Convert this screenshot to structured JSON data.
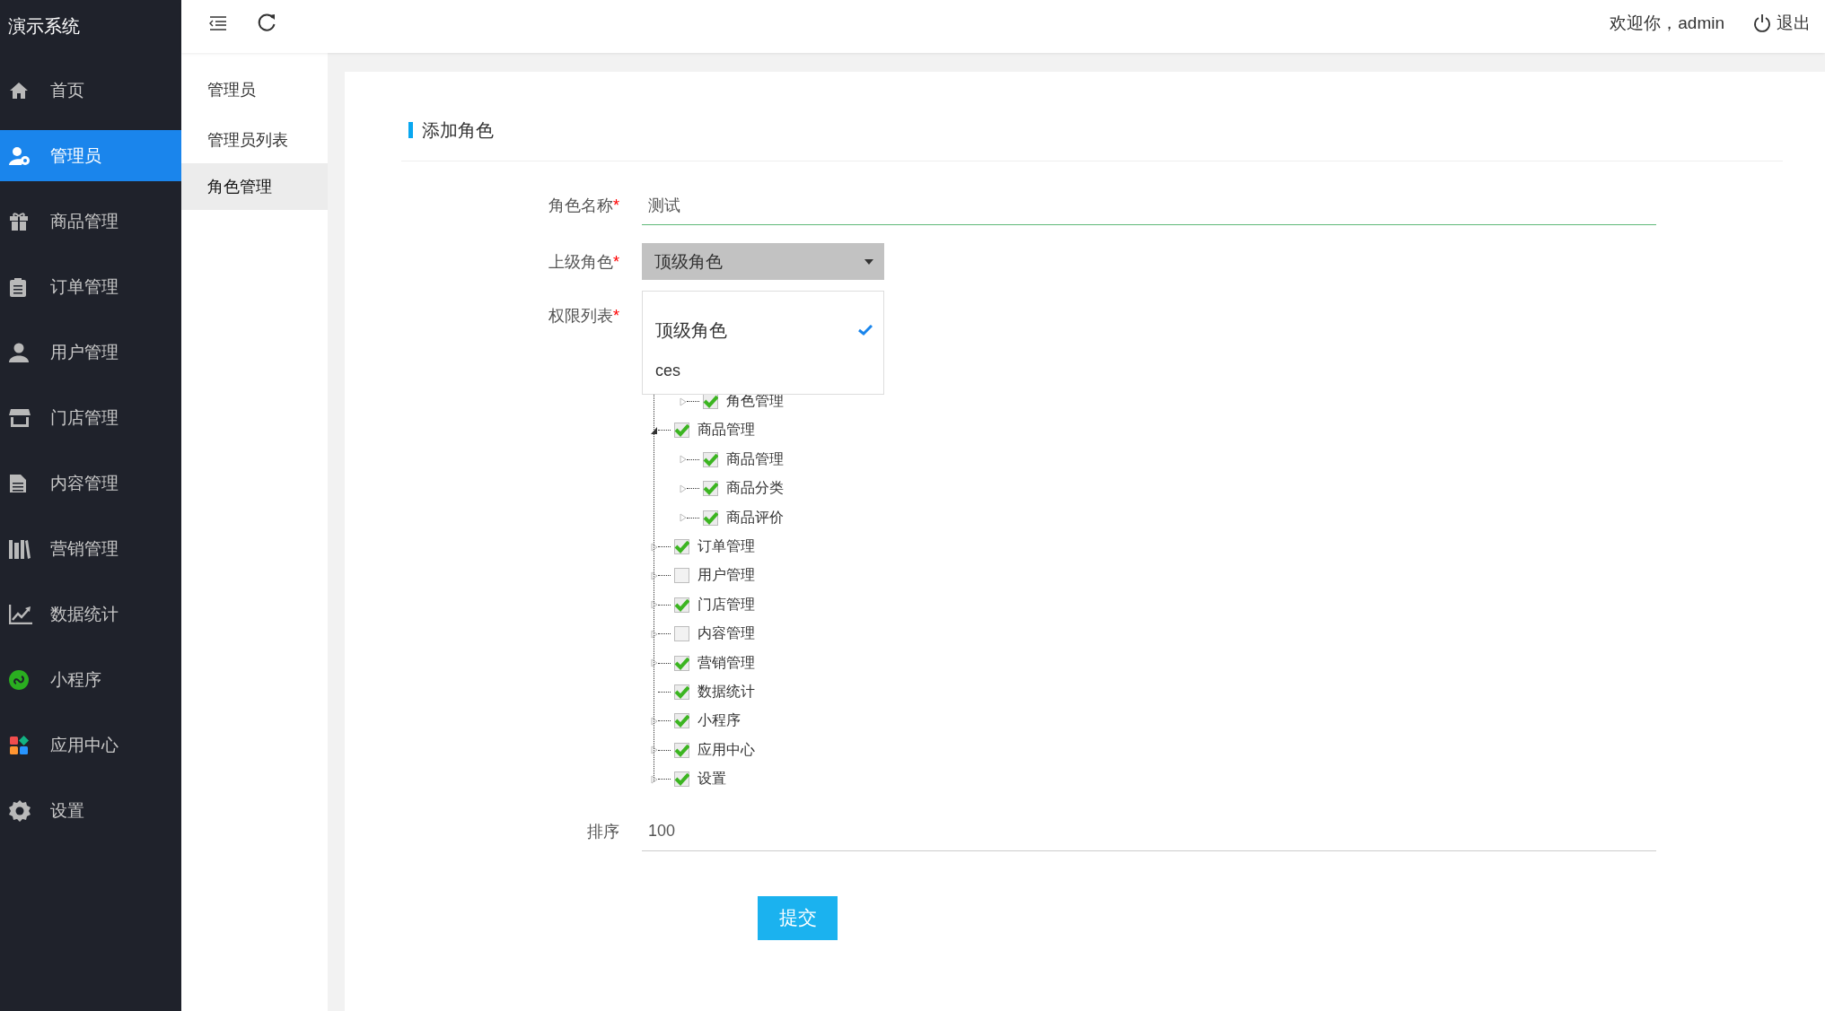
{
  "app": {
    "title": "演示系统"
  },
  "sidebar": {
    "items": [
      {
        "label": "首页",
        "selected": false
      },
      {
        "label": "管理员",
        "selected": true
      },
      {
        "label": "商品管理",
        "selected": false
      },
      {
        "label": "订单管理",
        "selected": false
      },
      {
        "label": "用户管理",
        "selected": false
      },
      {
        "label": "门店管理",
        "selected": false
      },
      {
        "label": "内容管理",
        "selected": false
      },
      {
        "label": "营销管理",
        "selected": false
      },
      {
        "label": "数据统计",
        "selected": false
      },
      {
        "label": "小程序",
        "selected": false
      },
      {
        "label": "应用中心",
        "selected": false
      },
      {
        "label": "设置",
        "selected": false
      }
    ]
  },
  "header": {
    "welcome": "欢迎你，admin",
    "logout": "退出"
  },
  "submenu": {
    "title": "管理员",
    "items": [
      {
        "label": "管理员列表",
        "selected": false
      },
      {
        "label": "角色管理",
        "selected": true
      }
    ]
  },
  "form": {
    "title": "添加角色",
    "name": {
      "label": "角色名称",
      "marker": "*",
      "value": "测试"
    },
    "parent": {
      "label": "上级角色",
      "marker": "*",
      "value": "顶级角色",
      "options": [
        {
          "label": "顶级角色",
          "selected": true
        },
        {
          "label": "ces",
          "selected": false
        }
      ]
    },
    "permissions": {
      "label": "权限列表",
      "marker": "*",
      "tree": [
        {
          "expanded": true,
          "children": [
            {
              "label": "角色管理",
              "checked": true,
              "expanded": false
            }
          ]
        },
        {
          "label": "商品管理",
          "checked": true,
          "expanded": true,
          "children": [
            {
              "label": "商品管理",
              "checked": true,
              "expanded": false
            },
            {
              "label": "商品分类",
              "checked": true,
              "expanded": false
            },
            {
              "label": "商品评价",
              "checked": true,
              "expanded": false
            }
          ]
        },
        {
          "label": "订单管理",
          "checked": true,
          "expanded": false
        },
        {
          "label": "用户管理",
          "checked": false,
          "expanded": false
        },
        {
          "label": "门店管理",
          "checked": true,
          "expanded": false
        },
        {
          "label": "内容管理",
          "checked": false,
          "expanded": false
        },
        {
          "label": "营销管理",
          "checked": true,
          "expanded": false
        },
        {
          "label": "数据统计",
          "checked": true
        },
        {
          "label": "小程序",
          "checked": true,
          "expanded": false
        },
        {
          "label": "应用中心",
          "checked": true,
          "expanded": false
        },
        {
          "label": "设置",
          "checked": true,
          "expanded": false
        }
      ]
    },
    "sort": {
      "label": "排序",
      "value": "100"
    },
    "submit": "提交"
  }
}
